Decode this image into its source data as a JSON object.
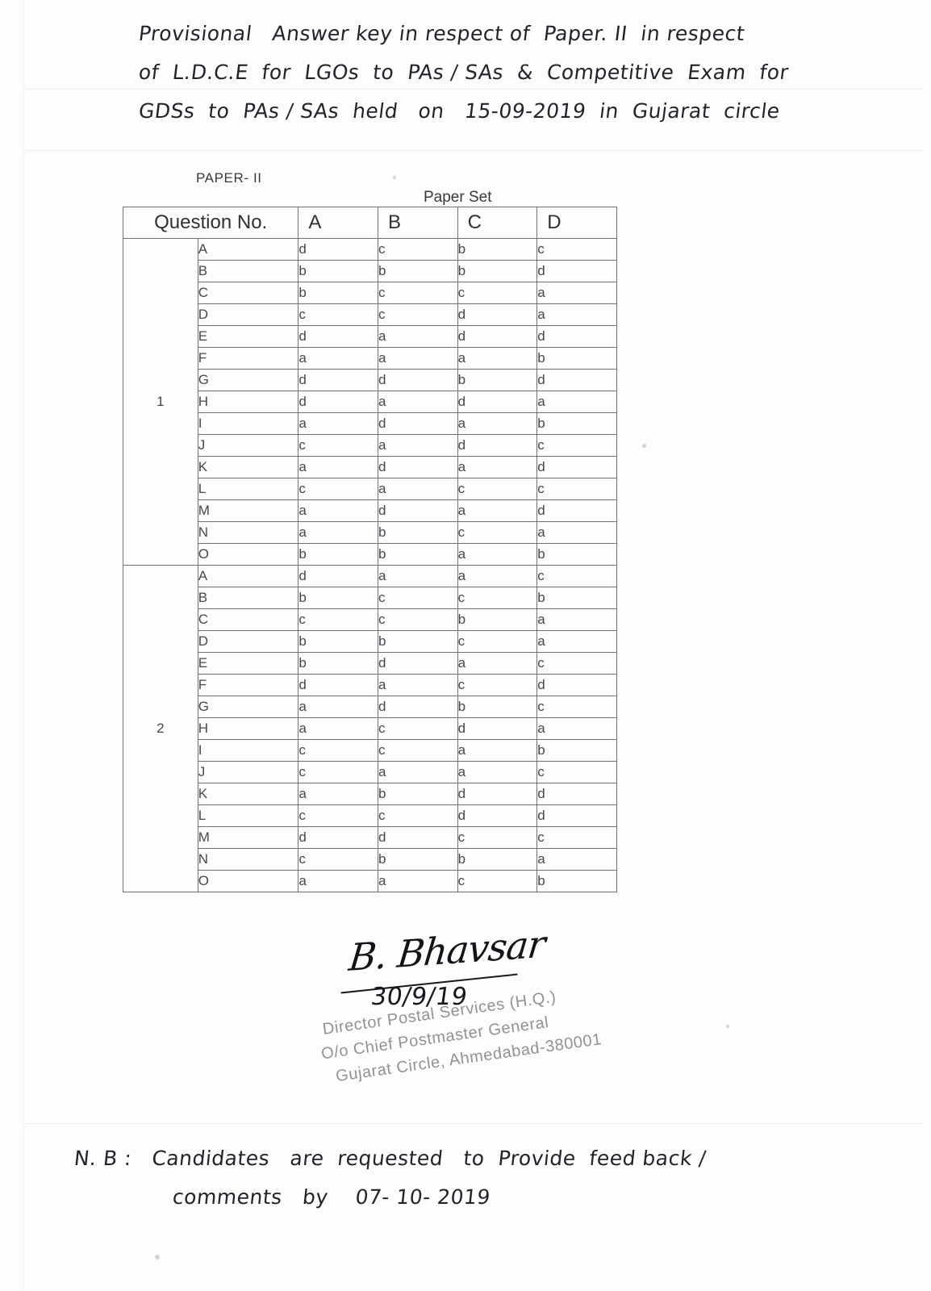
{
  "header": {
    "lines": [
      "Provisional   Answer key in respect of  Paper. II  in respect",
      "of  L.D.C.E  for  LGOs  to  PAs / SAs  &  Competitive  Exam  for",
      "GDSs  to  PAs / SAs  held   on   15-09-2019  in  Gujarat  circle"
    ]
  },
  "table": {
    "paper_label": "PAPER- II",
    "paper_set_caption": "Paper Set",
    "question_col_header": "Question No.",
    "set_headers": [
      "A",
      "B",
      "C",
      "D"
    ],
    "blocks": [
      {
        "question_no": "1",
        "rows": [
          {
            "sub": "A",
            "answers": [
              "d",
              "c",
              "b",
              "c"
            ]
          },
          {
            "sub": "B",
            "answers": [
              "b",
              "b",
              "b",
              "d"
            ]
          },
          {
            "sub": "C",
            "answers": [
              "b",
              "c",
              "c",
              "a"
            ]
          },
          {
            "sub": "D",
            "answers": [
              "c",
              "c",
              "d",
              "a"
            ]
          },
          {
            "sub": "E",
            "answers": [
              "d",
              "a",
              "d",
              "d"
            ]
          },
          {
            "sub": "F",
            "answers": [
              "a",
              "a",
              "a",
              "b"
            ]
          },
          {
            "sub": "G",
            "answers": [
              "d",
              "d",
              "b",
              "d"
            ]
          },
          {
            "sub": "H",
            "answers": [
              "d",
              "a",
              "d",
              "a"
            ]
          },
          {
            "sub": "I",
            "answers": [
              "a",
              "d",
              "a",
              "b"
            ]
          },
          {
            "sub": "J",
            "answers": [
              "c",
              "a",
              "d",
              "c"
            ]
          },
          {
            "sub": "K",
            "answers": [
              "a",
              "d",
              "a",
              "d"
            ]
          },
          {
            "sub": "L",
            "answers": [
              "c",
              "a",
              "c",
              "c"
            ]
          },
          {
            "sub": "M",
            "answers": [
              "a",
              "d",
              "a",
              "d"
            ]
          },
          {
            "sub": "N",
            "answers": [
              "a",
              "b",
              "c",
              "a"
            ]
          },
          {
            "sub": "O",
            "answers": [
              "b",
              "b",
              "a",
              "b"
            ]
          }
        ]
      },
      {
        "question_no": "2",
        "rows": [
          {
            "sub": "A",
            "answers": [
              "d",
              "a",
              "a",
              "c"
            ]
          },
          {
            "sub": "B",
            "answers": [
              "b",
              "c",
              "c",
              "b"
            ]
          },
          {
            "sub": "C",
            "answers": [
              "c",
              "c",
              "b",
              "a"
            ]
          },
          {
            "sub": "D",
            "answers": [
              "b",
              "b",
              "c",
              "a"
            ]
          },
          {
            "sub": "E",
            "answers": [
              "b",
              "d",
              "a",
              "c"
            ]
          },
          {
            "sub": "F",
            "answers": [
              "d",
              "a",
              "c",
              "d"
            ]
          },
          {
            "sub": "G",
            "answers": [
              "a",
              "d",
              "b",
              "c"
            ]
          },
          {
            "sub": "H",
            "answers": [
              "a",
              "c",
              "d",
              "a"
            ]
          },
          {
            "sub": "I",
            "answers": [
              "c",
              "c",
              "a",
              "b"
            ]
          },
          {
            "sub": "J",
            "answers": [
              "c",
              "a",
              "a",
              "c"
            ]
          },
          {
            "sub": "K",
            "answers": [
              "a",
              "b",
              "d",
              "d"
            ]
          },
          {
            "sub": "L",
            "answers": [
              "c",
              "c",
              "d",
              "d"
            ]
          },
          {
            "sub": "M",
            "answers": [
              "d",
              "d",
              "c",
              "c"
            ]
          },
          {
            "sub": "N",
            "answers": [
              "c",
              "b",
              "b",
              "a"
            ]
          },
          {
            "sub": "O",
            "answers": [
              "a",
              "a",
              "c",
              "b"
            ]
          }
        ]
      }
    ]
  },
  "signature": {
    "name_mark": "B. Bhavsar",
    "date": "30/9/19"
  },
  "stamp": {
    "line1": "Director Postal Services (H.Q.)",
    "line2": "O/o Chief Postmaster General",
    "line3": "Gujarat Circle, Ahmedabad-380001"
  },
  "note": {
    "lines": [
      "N. B :   Candidates   are  requested   to  Provide  feed back /",
      "comments   by    07- 10- 2019"
    ]
  }
}
